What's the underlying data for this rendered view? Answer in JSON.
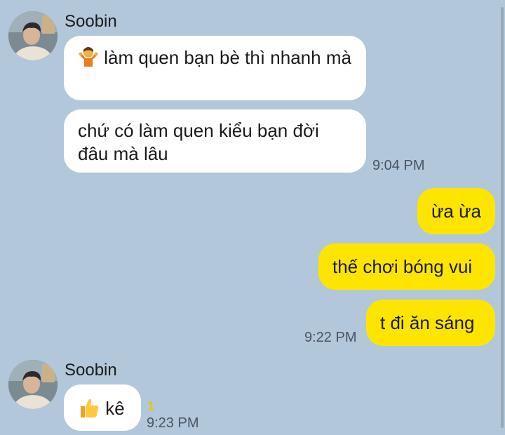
{
  "colors": {
    "background": "#b2c7da",
    "incoming_bubble": "#ffffff",
    "outgoing_bubble": "#fee500",
    "unread_count": "#e8c800"
  },
  "groups": [
    {
      "sender": "Soobin",
      "avatar_icon": "profile-photo",
      "messages": [
        {
          "emoji": "shrug-emoji",
          "text": "làm quen bạn bè thì nhanh mà"
        },
        {
          "text": "chứ có làm quen kiểu bạn đời đâu mà lâu"
        }
      ],
      "time": "9:04 PM"
    },
    {
      "sender": "me",
      "messages": [
        {
          "text": "ừa ừa"
        },
        {
          "text": "thế chơi bóng vui"
        },
        {
          "text": "t đi ăn sáng"
        }
      ],
      "time": "9:22 PM"
    },
    {
      "sender": "Soobin",
      "avatar_icon": "profile-photo",
      "messages": [
        {
          "emoji": "thumbs-up-emoji",
          "text": "kê",
          "unread": "1"
        }
      ],
      "time": "9:23 PM"
    }
  ]
}
